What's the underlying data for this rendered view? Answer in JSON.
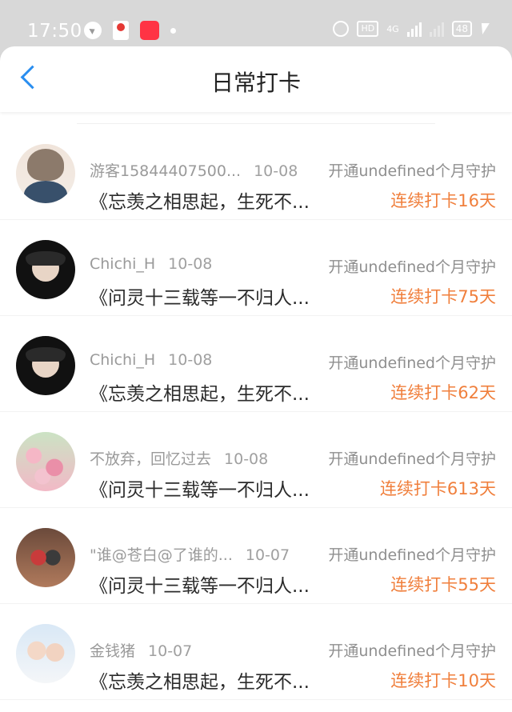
{
  "status_bar": {
    "time": "17:50",
    "network": "4G",
    "hd": "HD",
    "battery": "48"
  },
  "header": {
    "title": "日常打卡",
    "back_icon": "chevron-left-icon"
  },
  "colors": {
    "accent_blue": "#2a8ef0",
    "streak_orange": "#f07f3c",
    "meta_gray": "#9a9a9a"
  },
  "list": [
    {
      "name": "游客15844407500...",
      "date": "10-08",
      "member": "开通undefined个月守护",
      "text": "《忘羡之相思起，生死不...",
      "streak": "连续打卡16天"
    },
    {
      "name": "Chichi_H",
      "date": "10-08",
      "member": "开通undefined个月守护",
      "text": "《问灵十三载等一不归人...",
      "streak": "连续打卡75天"
    },
    {
      "name": "Chichi_H",
      "date": "10-08",
      "member": "开通undefined个月守护",
      "text": "《忘羡之相思起，生死不...",
      "streak": "连续打卡62天"
    },
    {
      "name": "不放弃，回忆过去",
      "date": "10-08",
      "member": "开通undefined个月守护",
      "text": "《问灵十三载等一不归人...",
      "streak": "连续打卡613天"
    },
    {
      "name": "\"谁@苍白@了谁的...",
      "date": "10-07",
      "member": "开通undefined个月守护",
      "text": "《问灵十三载等一不归人...",
      "streak": "连续打卡55天"
    },
    {
      "name": "金钱猪",
      "date": "10-07",
      "member": "开通undefined个月守护",
      "text": "《忘羡之相思起，生死不...",
      "streak": "连续打卡10天"
    }
  ]
}
